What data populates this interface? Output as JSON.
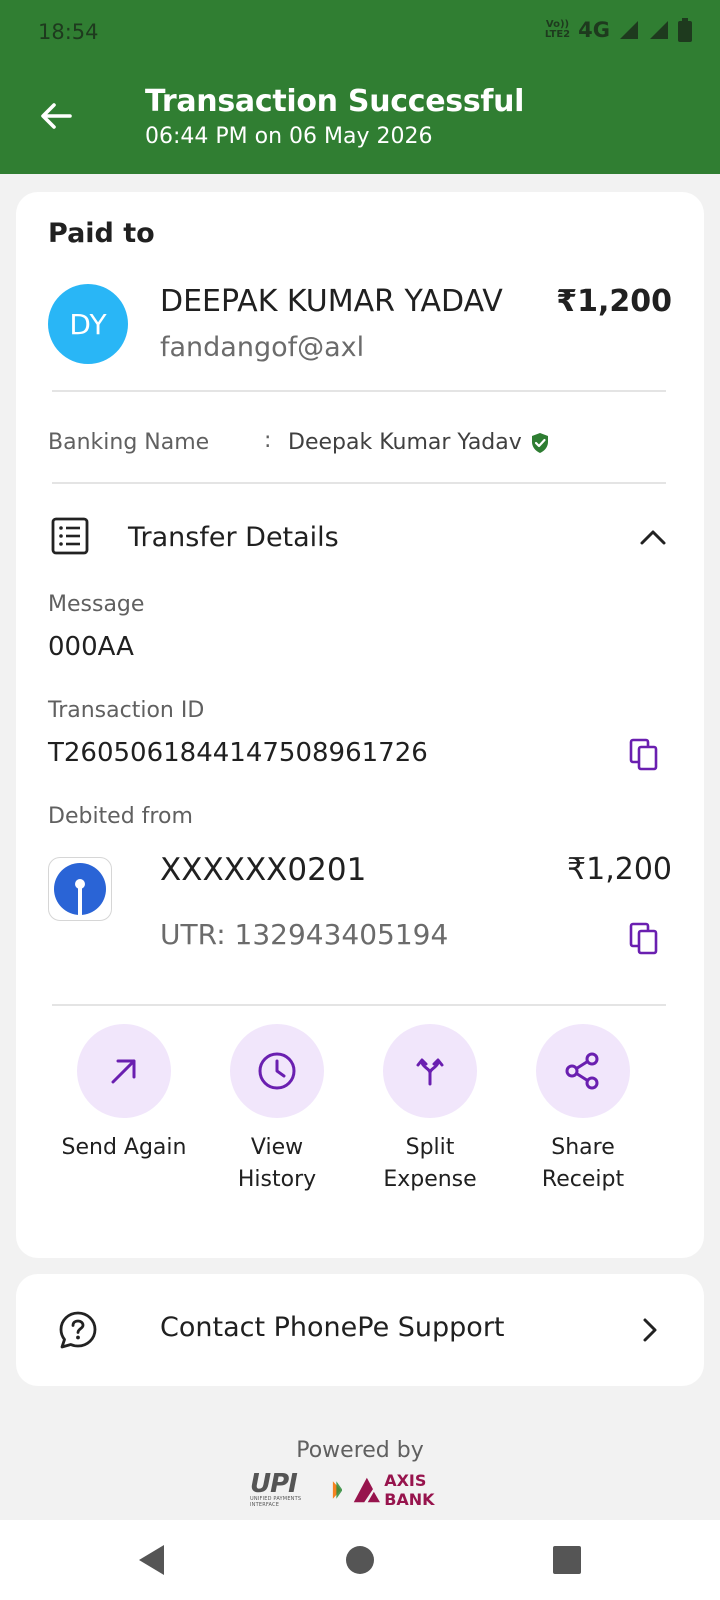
{
  "status_bar": {
    "time": "18:54",
    "volte": "VoLTE",
    "network": "4G"
  },
  "header": {
    "title": "Transaction Successful",
    "subtitle": "06:44 PM on 06 May 2026"
  },
  "payee": {
    "section_label": "Paid to",
    "initials": "DY",
    "name": "DEEPAK KUMAR YADAV",
    "upi_id": "fandangof@axl",
    "amount": "₹1,200",
    "banking_name_label": "Banking Name",
    "banking_name_sep": ":",
    "banking_name": "Deepak Kumar Yadav"
  },
  "transfer": {
    "title": "Transfer Details",
    "message_label": "Message",
    "message": "000AA",
    "txn_label": "Transaction ID",
    "txn_id": "T2605061844147508961726",
    "debited_label": "Debited from",
    "account": "XXXXXX0201",
    "account_amount": "₹1,200",
    "utr": "UTR: 132943405194"
  },
  "actions": [
    {
      "line1": "Send Again",
      "line2": ""
    },
    {
      "line1": "View",
      "line2": "History"
    },
    {
      "line1": "Split",
      "line2": "Expense"
    },
    {
      "line1": "Share",
      "line2": "Receipt"
    }
  ],
  "support": {
    "label": "Contact PhonePe Support"
  },
  "footer": {
    "powered_by": "Powered by",
    "upi": "UPI",
    "upi_sub": "UNIFIED PAYMENTS INTERFACE",
    "bank": "AXIS BANK"
  },
  "colors": {
    "header_green": "#307e32",
    "action_purple": "#6a1fb0",
    "avatar_blue": "#29b6f6"
  }
}
